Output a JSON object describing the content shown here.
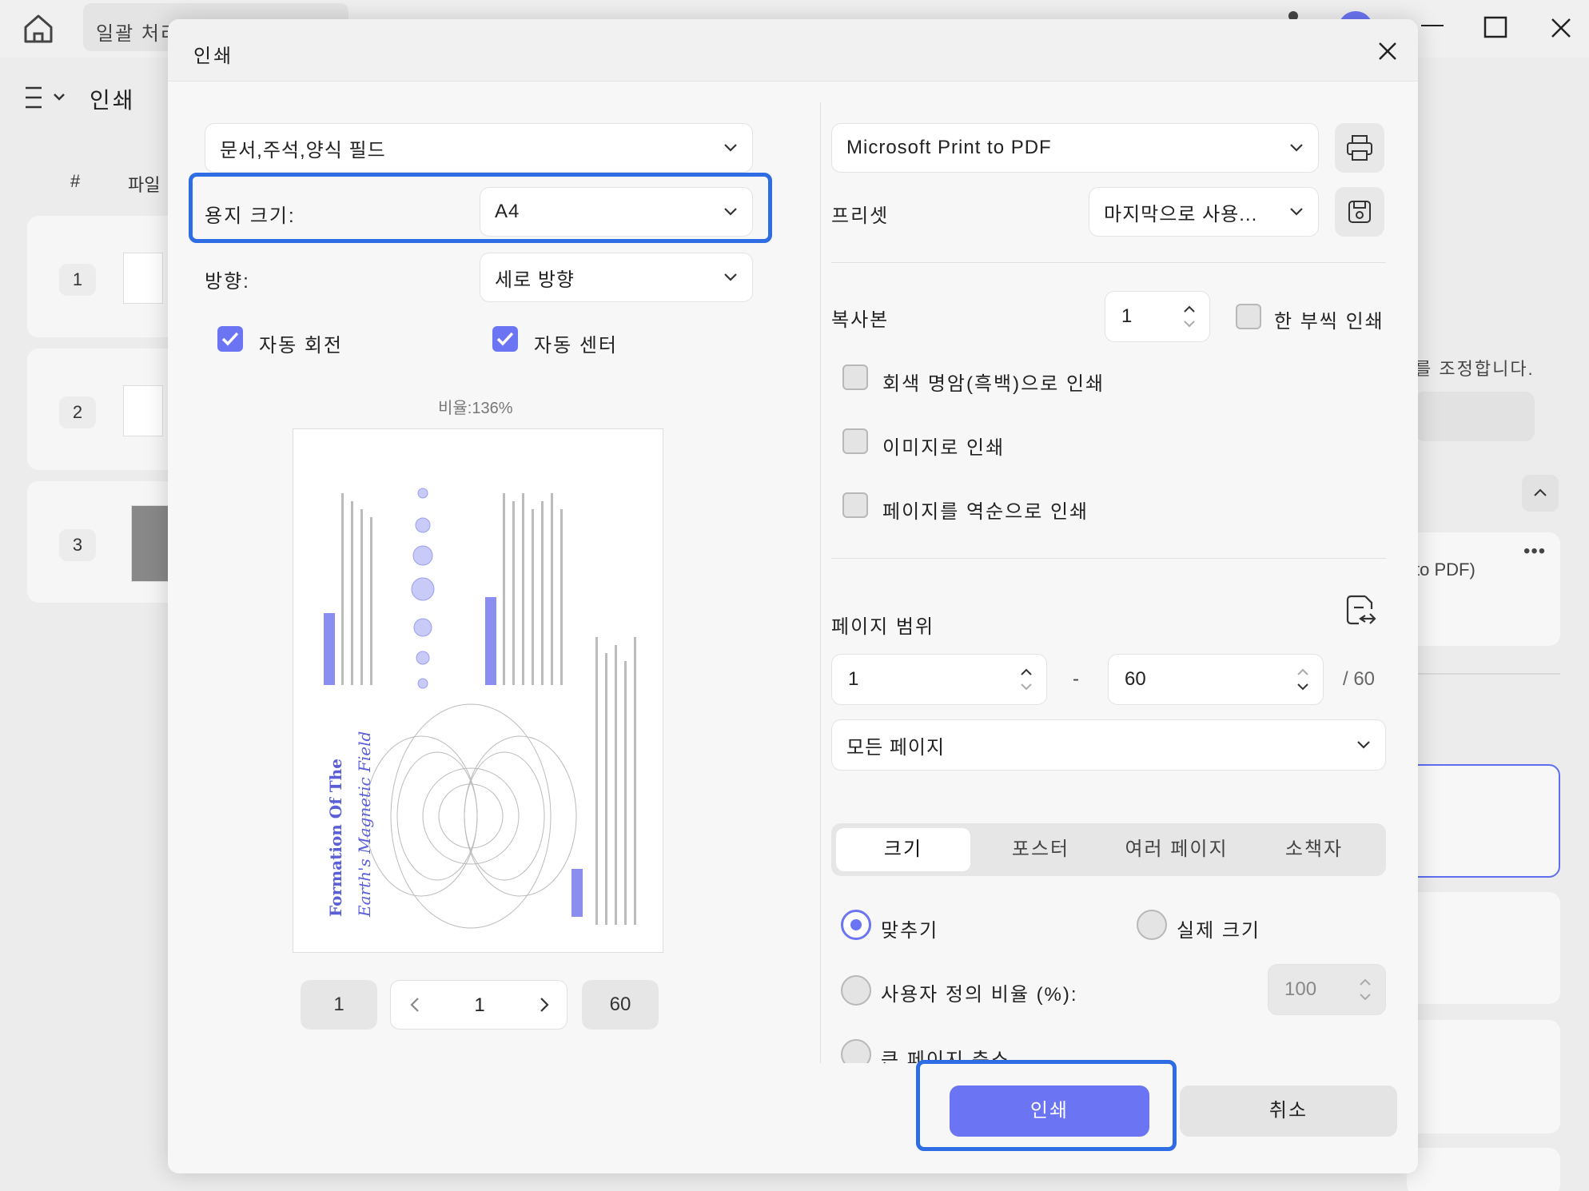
{
  "app": {
    "batch_tab": "일괄 처리",
    "page_title": "인쇄",
    "col_hash": "#",
    "col_file": "파일",
    "rows": [
      {
        "num": "1"
      },
      {
        "num": "2"
      },
      {
        "num": "3"
      }
    ],
    "right_text": "를 조정합니다.",
    "right_card_text": "to PDF)",
    "right_dots": "•••"
  },
  "dialog": {
    "title": "인쇄",
    "left": {
      "content_select": "문서,주석,양식 필드",
      "paper_size_label": "용지 크기:",
      "paper_size_value": "A4",
      "orientation_label": "방향:",
      "orientation_value": "세로 방향",
      "auto_rotate_label": "자동 회전",
      "auto_rotate_checked": true,
      "auto_center_label": "자동 센터",
      "auto_center_checked": true,
      "ratio_text": "비율:136%",
      "pager": {
        "first": "1",
        "current": "1",
        "last": "60"
      }
    },
    "right": {
      "printer": "Microsoft Print to PDF",
      "preset_label": "프리셋",
      "preset_value": "마지막으로 사용...",
      "copies_label": "복사본",
      "copies_value": "1",
      "collate_label": "한 부씩 인쇄",
      "grayscale_label": "회색 명암(흑백)으로 인쇄",
      "as_image_label": "이미지로 인쇄",
      "reverse_label": "페이지를 역순으로 인쇄",
      "page_range_label": "페이지 범위",
      "range_from": "1",
      "range_dash": "-",
      "range_to": "60",
      "range_total": "/ 60",
      "range_mode": "모든 페이지",
      "tabs": [
        "크기",
        "포스터",
        "여러 페이지",
        "소책자"
      ],
      "active_tab": "크기",
      "fit_label": "맞추기",
      "actual_size_label": "실제 크기",
      "custom_ratio_label": "사용자 정의 비율 (%):",
      "custom_ratio_value": "100",
      "shrink_label": "큰 페이지 축소"
    },
    "buttons": {
      "print": "인쇄",
      "cancel": "취소"
    }
  },
  "colors": {
    "accent": "#6b74f2",
    "highlight": "#2f6de4"
  }
}
